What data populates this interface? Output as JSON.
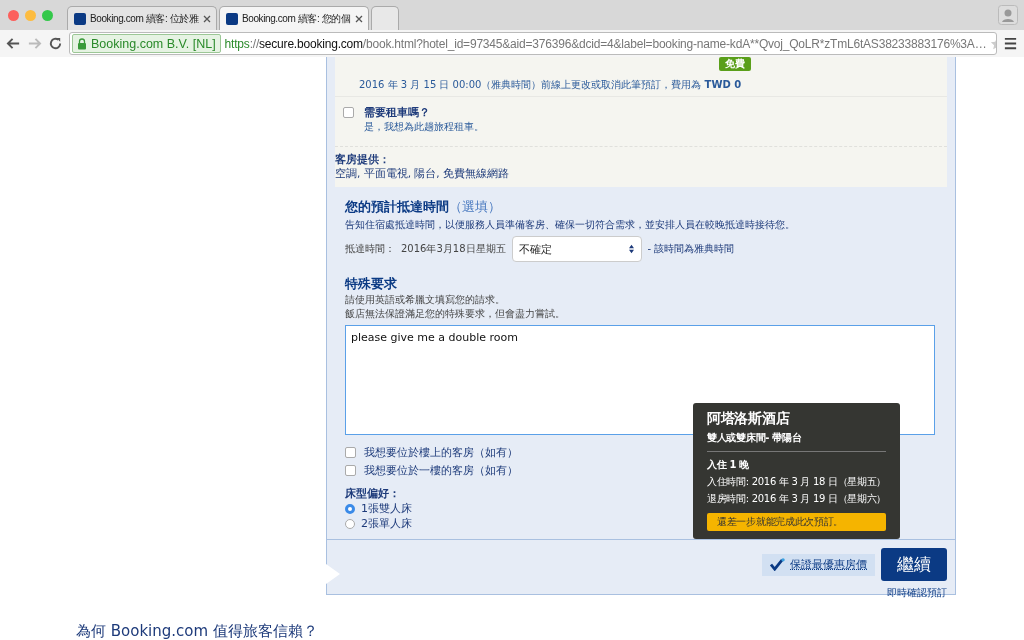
{
  "browser": {
    "tabs": [
      {
        "title": "Booking.com 續客: 位於雅",
        "selected": false
      },
      {
        "title": "Booking.com 續客: 您的個",
        "selected": true
      }
    ],
    "secure_label": "Booking.com B.V. [NL]",
    "url": [
      {
        "kind": "scheme",
        "text": "https"
      },
      {
        "kind": "rest",
        "text": "://"
      },
      {
        "kind": "host",
        "text": "secure.booking.com"
      },
      {
        "kind": "rest",
        "text": "/book.html?hotel_id=97345&aid=376396&dcid=4&label=booking-name-kdA**Qvoj_QoLR*zTmL6tAS38233883176%3A…"
      }
    ]
  },
  "cancellation": {
    "text": "2016 年 3 月 15 日 00:00（雅典時間）前線上更改或取消此筆預訂，費用為 **TWD 0**",
    "badge": "免費"
  },
  "car_rental": {
    "label": "需要租車嗎？",
    "sub": "是，我想為此趟旅程租車。",
    "checked": false
  },
  "amenities": {
    "label": "客房提供：",
    "text": "空調, 平面電視, 陽台, 免費無線網路"
  },
  "arrival": {
    "title": "您的預計抵達時間",
    "optional": "（選填）",
    "desc": "告知住宿處抵達時間，以便服務人員準備客房、確保一切符合需求，並安排人員在較晚抵達時接待您。",
    "label": "抵達時間：",
    "date": "2016年3月18日星期五",
    "select": "不確定",
    "note": "- 該時間為雅典時間"
  },
  "special": {
    "title": "特殊要求",
    "hints": [
      "請使用英語或希臘文填寫您的請求。",
      "飯店無法保證滿足您的特殊要求，但會盡力嘗試。"
    ],
    "value": "please give me a double room"
  },
  "floor_options": [
    {
      "label": "我想要位於樓上的客房（如有）",
      "checked": false
    },
    {
      "label": "我想要位於一樓的客房（如有）",
      "checked": false
    }
  ],
  "bed": {
    "label": "床型偏好：",
    "options": [
      {
        "label": "1張雙人床",
        "selected": true
      },
      {
        "label": "2張單人床",
        "selected": false
      }
    ]
  },
  "price_guarantee": "保證最優惠房價",
  "continue_button": "繼續",
  "confirm_note": "即時確認預訂",
  "tooltip": {
    "hotel": "阿塔洛斯酒店",
    "room": "雙人或雙床間- 帶陽台",
    "nights": "入住 1 晚",
    "checkin": "入住時間: 2016 年 3 月 18 日（星期五）",
    "checkout": "退房時間: 2016 年 3 月 19 日（星期六）",
    "notice": "還差一步就能完成此次預訂。"
  },
  "footer_heading": "為何 Booking.com 值得旅客信賴？"
}
